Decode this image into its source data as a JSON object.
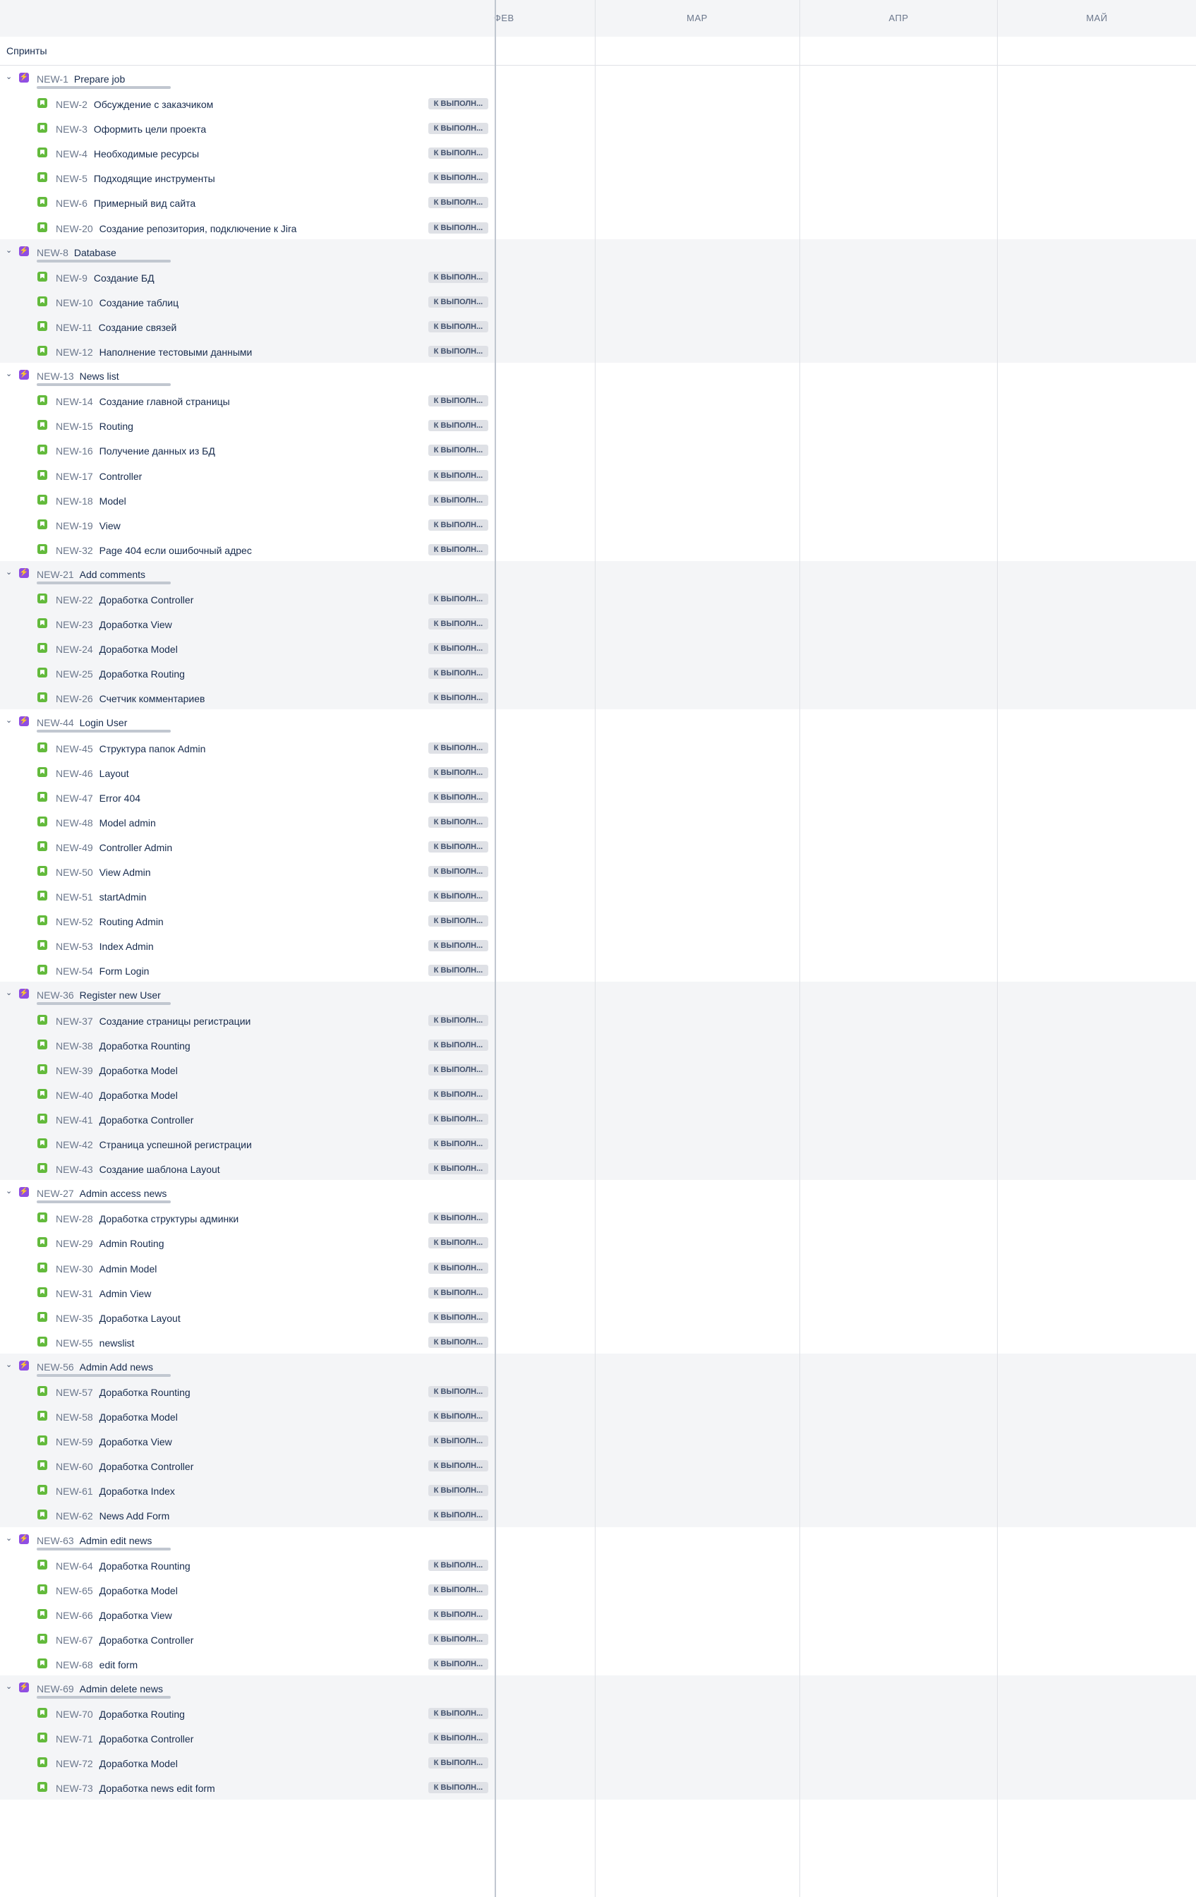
{
  "months": [
    "ФЕВ",
    "МАР",
    "АПР",
    "МАЙ"
  ],
  "sprints_label": "Спринты",
  "status_label": "К ВЫПОЛН...",
  "colors": {
    "epic": "#904ee2",
    "story": "#63ba3c",
    "alt_bg": "#f4f5f7"
  },
  "icons": {
    "epic": "epic-icon",
    "story": "story-icon",
    "toggle": "chevron-down-icon"
  },
  "epics": [
    {
      "key": "NEW-1",
      "title": "Prepare job",
      "stories": [
        {
          "key": "NEW-2",
          "title": "Обсуждение с заказчиком"
        },
        {
          "key": "NEW-3",
          "title": "Оформить цели проекта"
        },
        {
          "key": "NEW-4",
          "title": "Необходимые ресурсы"
        },
        {
          "key": "NEW-5",
          "title": "Подходящие инструменты"
        },
        {
          "key": "NEW-6",
          "title": "Примерный вид сайта"
        },
        {
          "key": "NEW-20",
          "title": "Создание репозитория, подключение к Jira"
        }
      ]
    },
    {
      "key": "NEW-8",
      "title": "Database",
      "stories": [
        {
          "key": "NEW-9",
          "title": "Создание БД"
        },
        {
          "key": "NEW-10",
          "title": "Создание таблиц"
        },
        {
          "key": "NEW-11",
          "title": "Создание связей"
        },
        {
          "key": "NEW-12",
          "title": "Наполнение тестовыми данными"
        }
      ]
    },
    {
      "key": "NEW-13",
      "title": "News list",
      "stories": [
        {
          "key": "NEW-14",
          "title": "Создание главной страницы"
        },
        {
          "key": "NEW-15",
          "title": "Routing"
        },
        {
          "key": "NEW-16",
          "title": "Получение данных из БД"
        },
        {
          "key": "NEW-17",
          "title": "Controller"
        },
        {
          "key": "NEW-18",
          "title": "Model"
        },
        {
          "key": "NEW-19",
          "title": "View"
        },
        {
          "key": "NEW-32",
          "title": "Page 404 если ошибочный адрес"
        }
      ]
    },
    {
      "key": "NEW-21",
      "title": "Add comments",
      "stories": [
        {
          "key": "NEW-22",
          "title": "Доработка Controller"
        },
        {
          "key": "NEW-23",
          "title": "Доработка View"
        },
        {
          "key": "NEW-24",
          "title": "Доработка Model"
        },
        {
          "key": "NEW-25",
          "title": "Доработка Routing"
        },
        {
          "key": "NEW-26",
          "title": "Счетчик комментариев"
        }
      ]
    },
    {
      "key": "NEW-44",
      "title": "Login User",
      "stories": [
        {
          "key": "NEW-45",
          "title": "Структура папок Admin"
        },
        {
          "key": "NEW-46",
          "title": "Layout"
        },
        {
          "key": "NEW-47",
          "title": "Error 404"
        },
        {
          "key": "NEW-48",
          "title": "Model admin"
        },
        {
          "key": "NEW-49",
          "title": "Controller Admin"
        },
        {
          "key": "NEW-50",
          "title": "View Admin"
        },
        {
          "key": "NEW-51",
          "title": "startAdmin"
        },
        {
          "key": "NEW-52",
          "title": "Routing Admin"
        },
        {
          "key": "NEW-53",
          "title": "Index Admin"
        },
        {
          "key": "NEW-54",
          "title": "Form Login"
        }
      ]
    },
    {
      "key": "NEW-36",
      "title": "Register new User",
      "stories": [
        {
          "key": "NEW-37",
          "title": "Создание страницы регистрации"
        },
        {
          "key": "NEW-38",
          "title": "Доработка Rounting"
        },
        {
          "key": "NEW-39",
          "title": "Доработка Model"
        },
        {
          "key": "NEW-40",
          "title": "Доработка Model"
        },
        {
          "key": "NEW-41",
          "title": "Доработка Controller"
        },
        {
          "key": "NEW-42",
          "title": "Страница успешной регистрации"
        },
        {
          "key": "NEW-43",
          "title": "Создание шаблона Layout"
        }
      ]
    },
    {
      "key": "NEW-27",
      "title": "Admin access news",
      "stories": [
        {
          "key": "NEW-28",
          "title": "Доработка структуры админки"
        },
        {
          "key": "NEW-29",
          "title": "Admin Routing"
        },
        {
          "key": "NEW-30",
          "title": "Admin Model"
        },
        {
          "key": "NEW-31",
          "title": "Admin View"
        },
        {
          "key": "NEW-35",
          "title": "Доработка Layout"
        },
        {
          "key": "NEW-55",
          "title": "newslist"
        }
      ]
    },
    {
      "key": "NEW-56",
      "title": "Admin Add news",
      "stories": [
        {
          "key": "NEW-57",
          "title": "Доработка Rounting"
        },
        {
          "key": "NEW-58",
          "title": "Доработка Model"
        },
        {
          "key": "NEW-59",
          "title": "Доработка View"
        },
        {
          "key": "NEW-60",
          "title": "Доработка Controller"
        },
        {
          "key": "NEW-61",
          "title": "Доработка Index"
        },
        {
          "key": "NEW-62",
          "title": "News Add Form"
        }
      ]
    },
    {
      "key": "NEW-63",
      "title": "Admin edit news",
      "stories": [
        {
          "key": "NEW-64",
          "title": "Доработка Rounting"
        },
        {
          "key": "NEW-65",
          "title": "Доработка Model"
        },
        {
          "key": "NEW-66",
          "title": "Доработка View"
        },
        {
          "key": "NEW-67",
          "title": "Доработка Controller"
        },
        {
          "key": "NEW-68",
          "title": "edit form"
        }
      ]
    },
    {
      "key": "NEW-69",
      "title": "Admin delete news",
      "stories": [
        {
          "key": "NEW-70",
          "title": "Доработка Routing"
        },
        {
          "key": "NEW-71",
          "title": "Доработка Controller"
        },
        {
          "key": "NEW-72",
          "title": "Доработка Model"
        },
        {
          "key": "NEW-73",
          "title": "Доработка news edit form"
        }
      ]
    }
  ]
}
